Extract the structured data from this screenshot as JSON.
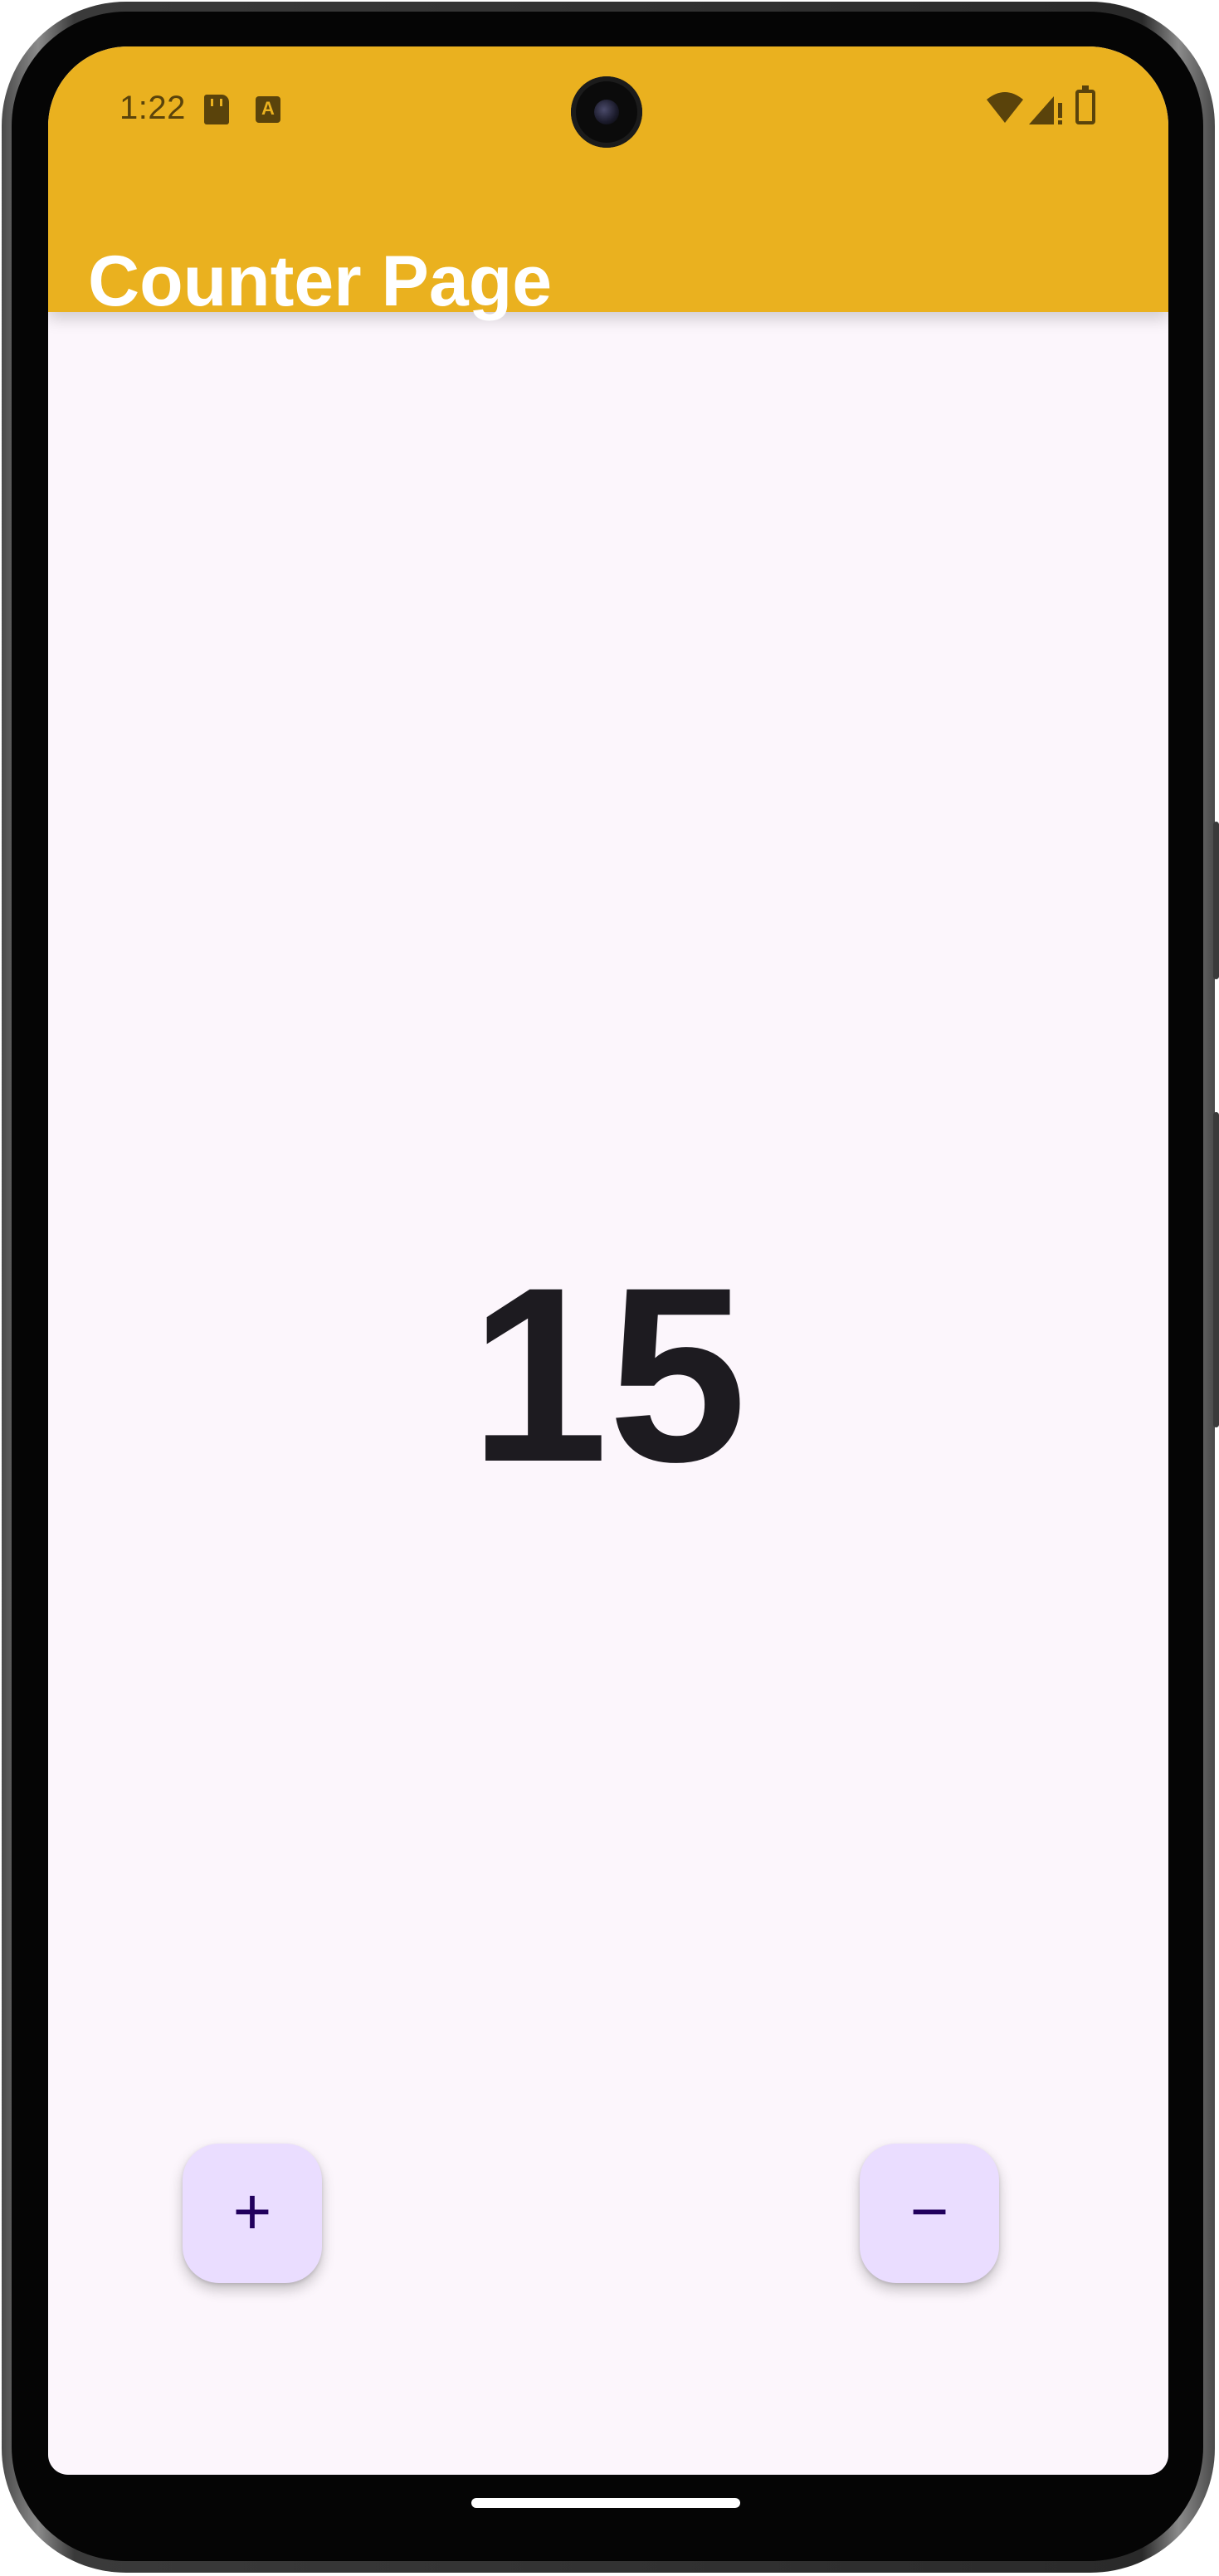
{
  "status_bar": {
    "time": "1:22",
    "a_badge": "A",
    "icons": [
      "sd-card-icon",
      "a-notification-icon",
      "wifi-icon",
      "cellular-icon",
      "battery-icon"
    ]
  },
  "app_bar": {
    "title": "Counter Page",
    "background_color": "#eab11f"
  },
  "counter": {
    "value": "15"
  },
  "fabs": {
    "increment_label": "+",
    "decrement_label": "−",
    "color": "#eaddff"
  }
}
